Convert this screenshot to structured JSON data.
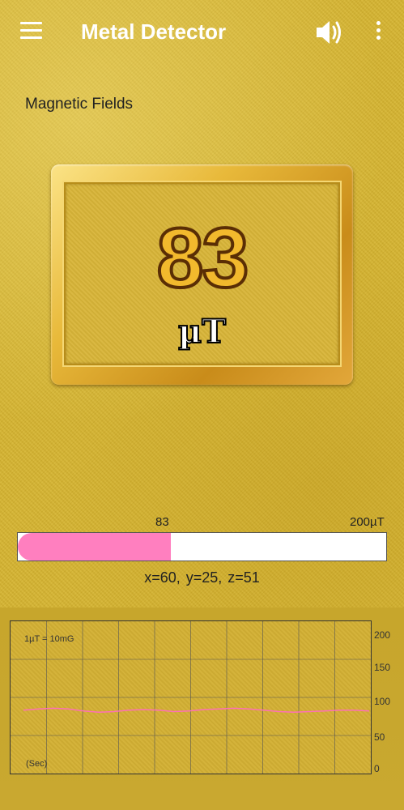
{
  "app": {
    "title": "Metal Detector"
  },
  "toolbar": {
    "menu_icon": "hamburger-menu-icon",
    "sound_icon": "speaker-volume-icon",
    "more_icon": "more-vertical-icon"
  },
  "section": {
    "label": "Magnetic Fields"
  },
  "reading": {
    "value": "83",
    "unit": "µT"
  },
  "meter": {
    "current_label": "83",
    "max_label": "200µT",
    "level_fraction": 0.415,
    "fill_color": "#ff7fbf"
  },
  "axes": {
    "readout": "x=60,  y=25,  z=51"
  },
  "graph": {
    "note": "1µT = 10mG",
    "x_unit": "(Sec)",
    "y_ticks": [
      "200",
      "150",
      "100",
      "50",
      "0"
    ],
    "line_color": "#ff6fb8"
  },
  "chart_data": {
    "type": "line",
    "xlabel": "(Sec)",
    "ylabel": "",
    "ylim": [
      0,
      200
    ],
    "grid": true,
    "series": [
      {
        "values": [
          88,
          90,
          91,
          90,
          87,
          85,
          86,
          88,
          89,
          88,
          86,
          87,
          89,
          90,
          91,
          90,
          88,
          86,
          85,
          86,
          87,
          88,
          88,
          87
        ]
      }
    ]
  }
}
